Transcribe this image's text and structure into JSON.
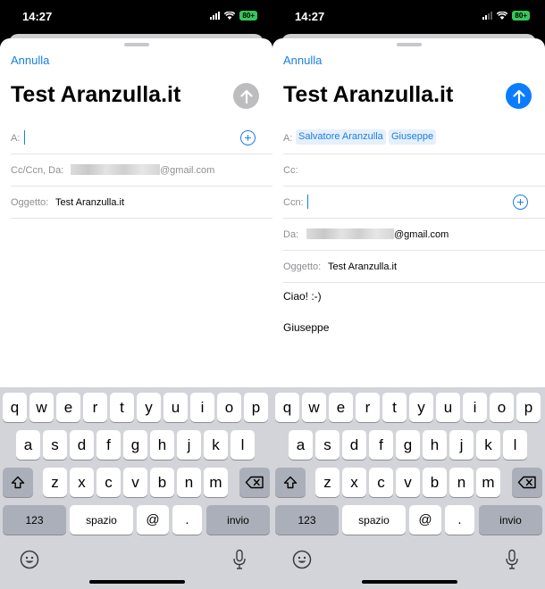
{
  "colors": {
    "accent": "#1a7ee4",
    "send_active": "#0a7cff",
    "send_disabled": "#bdbdbf",
    "battery": "#34c759"
  },
  "left": {
    "status": {
      "time": "14:27",
      "battery": "80+"
    },
    "cancel": "Annulla",
    "title": "Test Aranzulla.it",
    "to_label": "A:",
    "cc_label": "Cc/Ccn, Da:",
    "from_email_suffix": "@gmail.com",
    "subject_label": "Oggetto:",
    "subject_value": "Test Aranzulla.it",
    "send_icon": "arrow-up-icon",
    "add_icon": "plus-circle-icon"
  },
  "right": {
    "status": {
      "time": "14:27",
      "battery": "80+"
    },
    "cancel": "Annulla",
    "title": "Test Aranzulla.it",
    "to_label": "A:",
    "recipients": [
      "Salvatore Aranzulla",
      "Giuseppe"
    ],
    "cc_label": "Cc:",
    "bcc_label": "Ccn:",
    "from_label": "Da:",
    "from_email_suffix": "@gmail.com",
    "subject_label": "Oggetto:",
    "subject_value": "Test Aranzulla.it",
    "body": [
      "Ciao! :-)",
      "Giuseppe"
    ],
    "send_icon": "arrow-up-icon",
    "add_icon": "plus-circle-icon"
  },
  "keyboard": {
    "row1": [
      "q",
      "w",
      "e",
      "r",
      "t",
      "y",
      "u",
      "i",
      "o",
      "p"
    ],
    "row2": [
      "a",
      "s",
      "d",
      "f",
      "g",
      "h",
      "j",
      "k",
      "l"
    ],
    "row3": [
      "z",
      "x",
      "c",
      "v",
      "b",
      "n",
      "m"
    ],
    "numbers": "123",
    "space": "spazio",
    "at": "@",
    "dot": ".",
    "return": "invio",
    "shift_icon": "shift-icon",
    "delete_icon": "backspace-icon",
    "emoji_icon": "emoji-icon",
    "mic_icon": "microphone-icon"
  }
}
